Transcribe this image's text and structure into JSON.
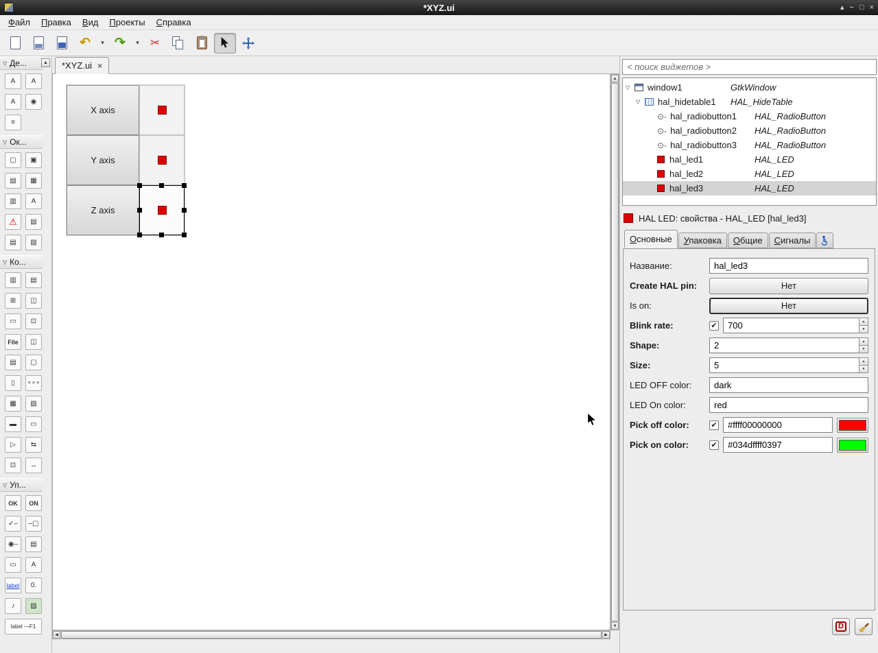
{
  "colors": {
    "led": "#dd0202",
    "swatch_off": "#ff0000",
    "swatch_on": "#00ff00"
  },
  "glyphs": {
    "expander_open": "▽",
    "dropdown": "▾",
    "close": "×",
    "undo": "↶",
    "redo": "↷",
    "cut": "✂",
    "check": "✔",
    "radio": "⊙-",
    "spin_up": "▲",
    "spin_down": "▼",
    "scroll_up": "▲",
    "scroll_down": "▼",
    "scroll_left": "◀",
    "scroll_right": "▶",
    "shade": "▴",
    "minimize": "−",
    "maximize": "□"
  },
  "titlebar": {
    "title": "*XYZ.ui"
  },
  "menubar": {
    "items": [
      {
        "m": "Ф",
        "rest": "айл"
      },
      {
        "m": "П",
        "rest": "равка"
      },
      {
        "m": "В",
        "rest": "ид"
      },
      {
        "m": "П",
        "rest": "роекты"
      },
      {
        "m": "С",
        "rest": "правка"
      }
    ]
  },
  "palette": {
    "sections": [
      {
        "label": "Де...",
        "icons": [
          {
            "name": "action-icon",
            "glyph": "A"
          },
          {
            "name": "toggle-action-icon",
            "glyph": "A"
          },
          {
            "name": "radio-action-icon",
            "glyph": "A"
          },
          {
            "name": "recent-action-icon",
            "glyph": "◉"
          },
          {
            "name": "action-group-icon",
            "glyph": "≡"
          }
        ]
      },
      {
        "label": "Ок...",
        "icons": [
          {
            "name": "window-icon",
            "glyph": "▢"
          },
          {
            "name": "dialog-icon",
            "glyph": "▣"
          },
          {
            "name": "about-dialog-icon",
            "glyph": "▤"
          },
          {
            "name": "color-selection-dialog-icon",
            "glyph": "▦"
          },
          {
            "name": "file-chooser-dialog-icon",
            "glyph": "▥"
          },
          {
            "name": "font-selection-dialog-icon",
            "glyph": "A"
          },
          {
            "name": "warning-dialog-icon",
            "glyph": "⚠"
          },
          {
            "name": "message-dialog-icon",
            "glyph": "▤"
          },
          {
            "name": "recent-chooser-dialog-icon",
            "glyph": "▤"
          },
          {
            "name": "assistant-icon",
            "glyph": "▧"
          }
        ]
      },
      {
        "label": "Ко...",
        "icons": [
          {
            "name": "hbox-icon",
            "glyph": "▥"
          },
          {
            "name": "vbox-icon",
            "glyph": "▤"
          },
          {
            "name": "table-icon",
            "glyph": "⊞"
          },
          {
            "name": "notebook-icon",
            "glyph": "◫"
          },
          {
            "name": "frame-icon",
            "glyph": "▭"
          },
          {
            "name": "aspect-frame-icon",
            "glyph": "⊡"
          },
          {
            "name": "file-chooser-button-icon",
            "glyph": "File"
          },
          {
            "name": "paned-icon",
            "glyph": "◫"
          },
          {
            "name": "combo-entry-icon",
            "glyph": "▤"
          },
          {
            "name": "viewport-icon",
            "glyph": "▢"
          },
          {
            "name": "blank-container-icon",
            "glyph": "▯"
          },
          {
            "name": "toolbar-icon",
            "glyph": "∘∘∘"
          },
          {
            "name": "icon-view-icon",
            "glyph": "▦"
          },
          {
            "name": "scrolled-window-icon",
            "glyph": "▧"
          },
          {
            "name": "menu-bar-icon",
            "glyph": "▬"
          },
          {
            "name": "statusbar-icon",
            "glyph": "▭"
          },
          {
            "name": "expander-icon",
            "glyph": "▷"
          },
          {
            "name": "size-group-icon",
            "glyph": "⇆"
          },
          {
            "name": "fixed-icon",
            "glyph": "⊡"
          },
          {
            "name": "layout-icon",
            "glyph": "↔"
          }
        ]
      },
      {
        "label": "Уп...",
        "icons": [
          {
            "name": "button-icon",
            "glyph": "OK"
          },
          {
            "name": "toggle-button-icon",
            "glyph": "ON"
          },
          {
            "name": "check-button-icon",
            "glyph": "✓–"
          },
          {
            "name": "switch-icon",
            "glyph": "–▢"
          },
          {
            "name": "radio-button-icon",
            "glyph": "◉–"
          },
          {
            "name": "combo-box-icon",
            "glyph": "▤"
          },
          {
            "name": "entry-icon",
            "glyph": "▭"
          },
          {
            "name": "text-view-icon",
            "glyph": "A"
          },
          {
            "name": "link-button-icon",
            "glyph": "label"
          },
          {
            "name": "spin-button-icon",
            "glyph": "0."
          },
          {
            "name": "volume-button-icon",
            "glyph": "♪"
          },
          {
            "name": "image-icon",
            "glyph": "▨"
          },
          {
            "name": "accel-label-icon",
            "glyph": "label —F1"
          }
        ]
      }
    ]
  },
  "editor": {
    "tab_label": "*XYZ.ui",
    "design": {
      "cells": [
        {
          "label": "X axis"
        },
        {
          "label": "Y axis"
        },
        {
          "label": "Z axis",
          "selected": true
        }
      ]
    }
  },
  "inspector": {
    "search_placeholder": "< поиск виджетов >",
    "tree": [
      {
        "name": "window1",
        "type": "GtkWindow"
      },
      {
        "name": "hal_hidetable1",
        "type": "HAL_HideTable"
      },
      {
        "name": "hal_radiobutton1",
        "type": "HAL_RadioButton"
      },
      {
        "name": "hal_radiobutton2",
        "type": "HAL_RadioButton"
      },
      {
        "name": "hal_radiobutton3",
        "type": "HAL_RadioButton"
      },
      {
        "name": "hal_led1",
        "type": "HAL_LED"
      },
      {
        "name": "hal_led2",
        "type": "HAL_LED"
      },
      {
        "name": "hal_led3",
        "type": "HAL_LED",
        "selected": true
      }
    ]
  },
  "properties": {
    "header": "HAL LED: свойства - HAL_LED [hal_led3]",
    "tabs": [
      {
        "m": "О",
        "rest": "сновные",
        "active": true
      },
      {
        "m": "У",
        "rest": "паковка"
      },
      {
        "m": "О",
        "rest": "бщие"
      },
      {
        "m": "С",
        "rest": "игналы"
      }
    ],
    "rows": {
      "name": {
        "label": "Название:",
        "value": "hal_led3"
      },
      "create_hal_pin": {
        "label": "Create HAL pin:",
        "value": "Нет"
      },
      "is_on": {
        "label": "Is on:",
        "value": "Нет"
      },
      "blink_rate": {
        "label": "Blink rate:",
        "value": "700",
        "checked": true
      },
      "shape": {
        "label": "Shape:",
        "value": "2"
      },
      "size": {
        "label": "Size:",
        "value": "5"
      },
      "led_off_color": {
        "label": "LED OFF color:",
        "value": "dark"
      },
      "led_on_color": {
        "label": "LED On color:",
        "value": "red"
      },
      "pick_off_color": {
        "label": "Pick off color:",
        "value": "#ffff00000000",
        "checked": true,
        "swatch": "#ff0000"
      },
      "pick_on_color": {
        "label": "Pick on color:",
        "value": "#034dffff0397",
        "checked": true,
        "swatch": "#00ff00"
      }
    }
  },
  "bottom": {
    "devhelp": "D"
  }
}
